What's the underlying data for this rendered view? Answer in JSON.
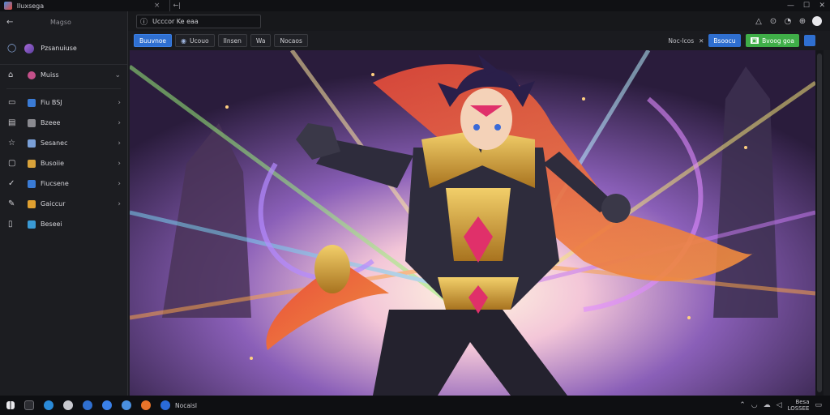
{
  "window": {
    "title": "Iluxsega",
    "close_glyph": "×",
    "address_prefix": "←|",
    "controls": [
      "—",
      "☐",
      "✕"
    ]
  },
  "nav": {
    "back": "←",
    "app_label": "Magso"
  },
  "sidebar": {
    "profile_label": "Pzsanuiuse",
    "items": [
      {
        "label": "Muiss",
        "icon": "home-icon",
        "sub_color": "#c4508a",
        "chevron": "⌄"
      },
      {
        "label": "Fiu BSJ",
        "icon": "folder-icon",
        "sub_color": "#3a7bd5",
        "chevron": "›"
      },
      {
        "label": "Bzeee",
        "icon": "list-icon",
        "sub_color": "#8a8a90",
        "chevron": "›"
      },
      {
        "label": "Sesanec",
        "icon": "star-icon",
        "sub_color": "#7aa0d8",
        "chevron": "›"
      },
      {
        "label": "Busoiie",
        "icon": "folder-icon",
        "sub_color": "#d8a23a",
        "chevron": "›"
      },
      {
        "label": "Fiucsene",
        "icon": "check-icon",
        "sub_color": "#3a7bd5",
        "chevron": "›"
      },
      {
        "label": "Gaiccur",
        "icon": "pen-icon",
        "sub_color": "#e0a030",
        "chevron": "›"
      },
      {
        "label": "Beseei",
        "icon": "doc-icon",
        "sub_color": "#3a9ad5",
        "chevron": ""
      }
    ]
  },
  "toolbar": {
    "address_label": "Ucccor Ke eaa",
    "right_icons": [
      "△",
      "⊙",
      "◔",
      "⊕"
    ]
  },
  "tabs": {
    "items": [
      {
        "label": "Buuvnoe",
        "active": true
      },
      {
        "label": "Ucouo",
        "active": false
      },
      {
        "label": "Ilnsen",
        "active": false
      },
      {
        "label": "Wa",
        "active": false
      },
      {
        "label": "Nocaos",
        "active": false
      }
    ],
    "right_text": "Noc-lcos",
    "filter_glyph": "✕",
    "primary_button": "Bsoocu",
    "green_button": "Bvoog goa"
  },
  "taskbar": {
    "pinned_label": "Nocaisl",
    "clock_time": "Besa",
    "clock_date": "LOSSEE"
  },
  "colors": {
    "accent": "#2f6fd0",
    "success": "#3fae48",
    "bg": "#1b1c20"
  }
}
